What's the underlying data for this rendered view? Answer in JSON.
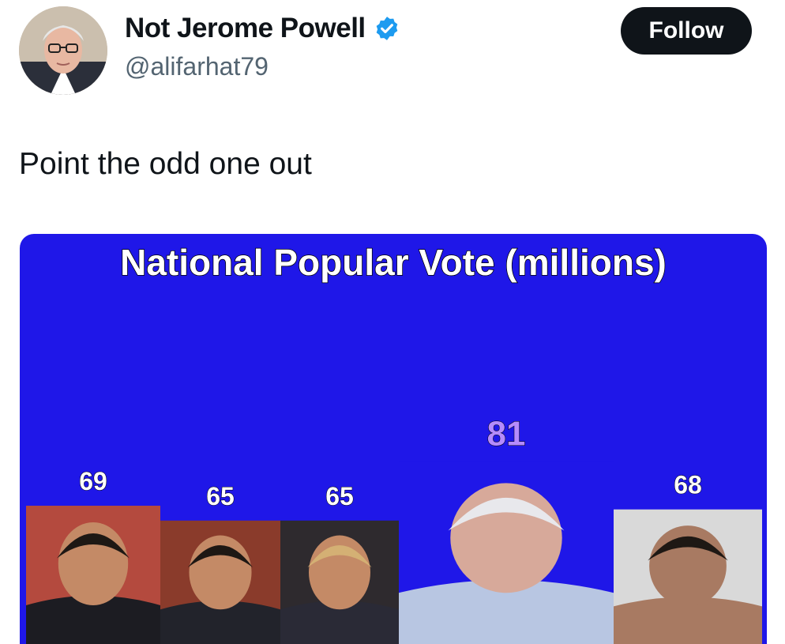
{
  "author": {
    "name": "Not Jerome Powell",
    "handle": "@alifarhat79",
    "verified_icon": "verified-badge-icon"
  },
  "follow_label": "Follow",
  "tweet_text": "Point the odd one out",
  "chart_data": {
    "type": "bar",
    "title": "National Popular Vote (millions)",
    "categories": [
      "",
      "",
      "",
      "",
      ""
    ],
    "values": [
      69,
      65,
      65,
      81,
      68
    ],
    "colors": {
      "background": "#1f17e8",
      "title": "#ffffff",
      "labels": "#ffffff",
      "highlight_label": "#b58bff"
    }
  }
}
